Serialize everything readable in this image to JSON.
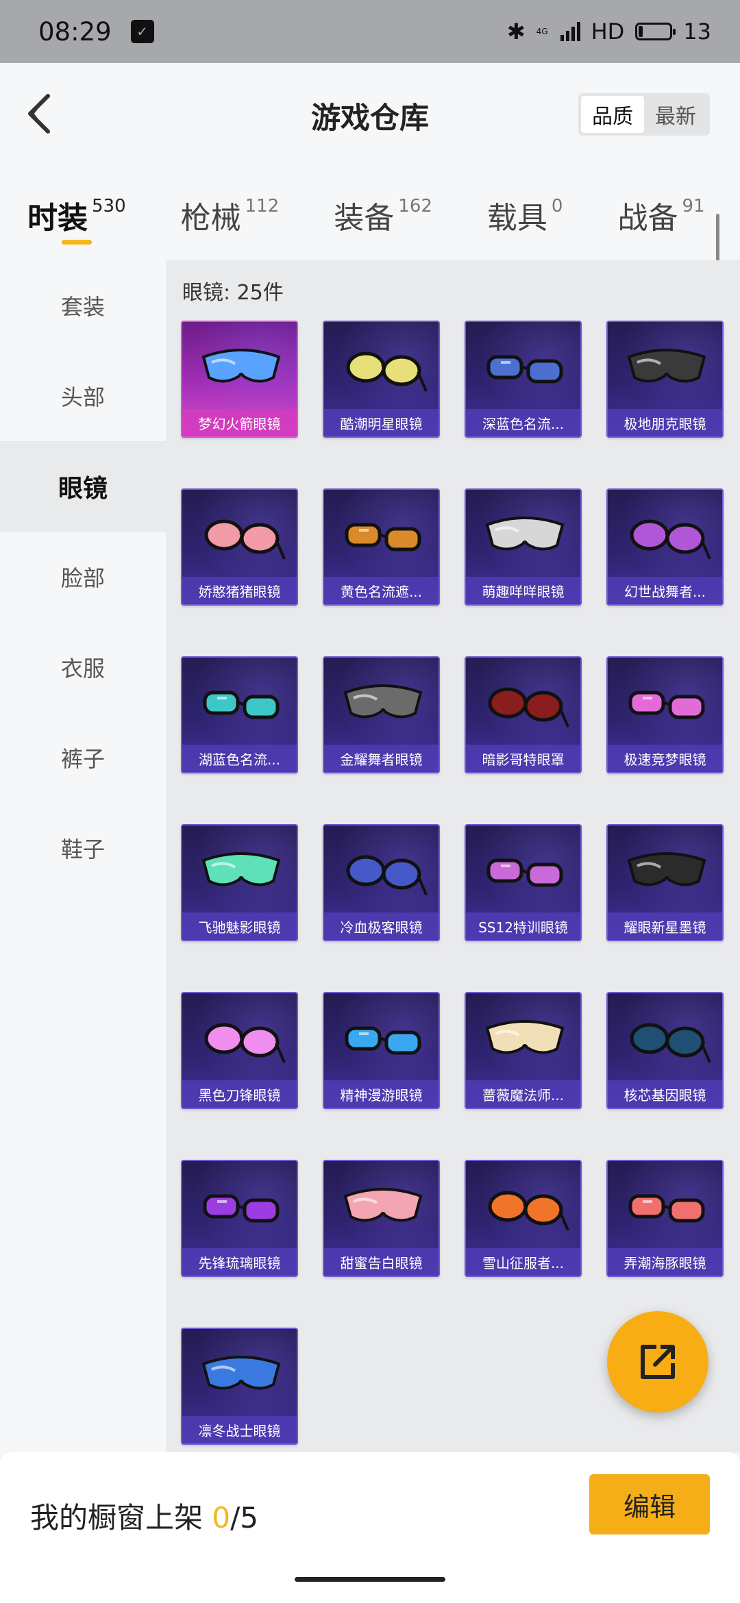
{
  "status_bar": {
    "time": "08:29",
    "network_small": "4G",
    "hd": "HD",
    "battery": "13",
    "icons": [
      "notification-icon",
      "bluetooth-icon",
      "signal-icon",
      "battery-icon"
    ]
  },
  "header": {
    "title": "游戏仓库",
    "sort_options": [
      "品质",
      "最新"
    ]
  },
  "tabs": [
    {
      "label": "时装",
      "count": "530"
    },
    {
      "label": "枪械",
      "count": "112"
    },
    {
      "label": "装备",
      "count": "162"
    },
    {
      "label": "载具",
      "count": "0"
    },
    {
      "label": "战备",
      "count": "91"
    }
  ],
  "sidebar": [
    {
      "label": "套装"
    },
    {
      "label": "头部"
    },
    {
      "label": "眼镜"
    },
    {
      "label": "脸部"
    },
    {
      "label": "衣服"
    },
    {
      "label": "裤子"
    },
    {
      "label": "鞋子"
    }
  ],
  "section": {
    "title": "眼镜: 25件"
  },
  "items": [
    {
      "name": "梦幻火箭眼镜",
      "color": "#5aa2ff",
      "rarity": "legendary"
    },
    {
      "name": "酷潮明星眼镜",
      "color": "#e8df7a"
    },
    {
      "name": "深蓝色名流...",
      "color": "#4c6fd1"
    },
    {
      "name": "极地朋克眼镜",
      "color": "#3a3a3a"
    },
    {
      "name": "娇憨猪猪眼镜",
      "color": "#f29aa8"
    },
    {
      "name": "黄色名流遮...",
      "color": "#d98a2a"
    },
    {
      "name": "萌趣咩咩眼镜",
      "color": "#d7d7d7"
    },
    {
      "name": "幻世战舞者...",
      "color": "#b057d8"
    },
    {
      "name": "湖蓝色名流...",
      "color": "#3ec7c7"
    },
    {
      "name": "金耀舞者眼镜",
      "color": "#6b6b6b"
    },
    {
      "name": "暗影哥特眼罩",
      "color": "#8a1e1e"
    },
    {
      "name": "极速竞梦眼镜",
      "color": "#e36bd8"
    },
    {
      "name": "飞驰魅影眼镜",
      "color": "#5ee0b8"
    },
    {
      "name": "冷血极客眼镜",
      "color": "#4559c9"
    },
    {
      "name": "SS12特训眼镜",
      "color": "#c86ad8"
    },
    {
      "name": "耀眼新星墨镜",
      "color": "#2b2b2b"
    },
    {
      "name": "黑色刀锋眼镜",
      "color": "#f08ef0"
    },
    {
      "name": "精神漫游眼镜",
      "color": "#3aa8f0"
    },
    {
      "name": "蔷薇魔法师...",
      "color": "#f1dfb8"
    },
    {
      "name": "核芯基因眼镜",
      "color": "#1f4f73"
    },
    {
      "name": "先锋琉璃眼镜",
      "color": "#9b3de0"
    },
    {
      "name": "甜蜜告白眼镜",
      "color": "#f3a5b4"
    },
    {
      "name": "雪山征服者...",
      "color": "#f0742a"
    },
    {
      "name": "弄潮海豚眼镜",
      "color": "#f07070"
    },
    {
      "name": "凛冬战士眼镜",
      "color": "#3a7ae0"
    }
  ],
  "bottom_bar": {
    "showcase_label": "我的橱窗上架",
    "showcase_current": "0",
    "showcase_total": "/5",
    "edit_label": "编辑"
  }
}
